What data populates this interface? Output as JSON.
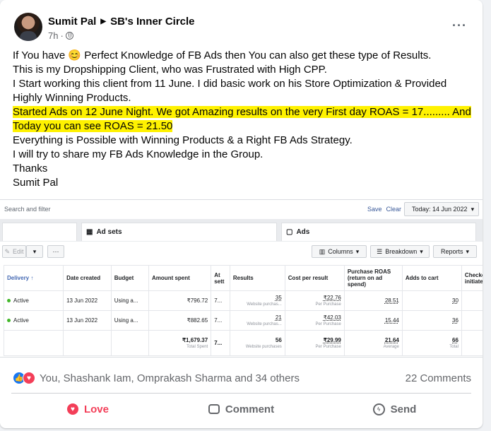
{
  "post": {
    "author": "Sumit Pal",
    "group": "SB's Inner Circle",
    "time": "7h",
    "lines": [
      "If You have 😊 Perfect Knowledge of FB Ads then You can also get these type of Results.",
      "This is my Dropshipping Client, who was Frustrated with High CPP.",
      "I Start working this client from 11 June. I did basic work on his Store Optimization & Provided",
      "Highly Winning Products."
    ],
    "highlight_lines": [
      "Started Ads on 12 June Night. We got Amazing results on the very First day ROAS = 17......... And",
      "Today you can see ROAS = 21.50 "
    ],
    "lines_after": [
      "Everything is Possible with Winning Products & a Right FB Ads Strategy.",
      "I will try to share my FB Ads Knowledge in the Group.",
      "Thanks",
      "Sumit Pal"
    ]
  },
  "ads_manager": {
    "search_placeholder": "Search and filter",
    "save": "Save",
    "clear": "Clear",
    "date": "Today: 14 Jun 2022",
    "tabs": {
      "adsets": "Ad sets",
      "ads": "Ads"
    },
    "toolbar": {
      "edit": "Edit",
      "dots": "···",
      "columns": "Columns",
      "breakdown": "Breakdown",
      "reports": "Reports"
    },
    "headers": [
      "Delivery ↑",
      "Date created",
      "Budget",
      "Amount spent",
      "At sett",
      "Results",
      "Cost per result",
      "Purchase ROAS (return on ad spend)",
      "Adds to cart",
      "Checkout initiated"
    ],
    "rows": [
      {
        "delivery": "Active",
        "date": "13 Jun 2022",
        "budget": "Using a...",
        "spent": "₹796.72",
        "at": "7...",
        "results": "35",
        "results_sub": "Website purchas...",
        "cpr": "₹22.76",
        "cpr_sub": "Per Purchase",
        "roas": "28.51",
        "atc": "30"
      },
      {
        "delivery": "Active",
        "date": "13 Jun 2022",
        "budget": "Using a...",
        "spent": "₹882.65",
        "at": "7...",
        "results": "21",
        "results_sub": "Website purchas...",
        "cpr": "₹42.03",
        "cpr_sub": "Per Purchase",
        "roas": "15.44",
        "atc": "36"
      }
    ],
    "total": {
      "spent": "₹1,679.37",
      "spent_sub": "Total Spent",
      "at": "7...",
      "results": "56",
      "results_sub": "Website purchases",
      "cpr": "₹29.99",
      "cpr_sub": "Per Purchase",
      "roas": "21.64",
      "roas_sub": "Average",
      "atc": "66",
      "atc_sub": "Total"
    }
  },
  "footer": {
    "reactions_text": "You, Shashank Iam, Omprakash Sharma and 34 others",
    "comments": "22 Comments",
    "love": "Love",
    "comment": "Comment",
    "send": "Send"
  }
}
